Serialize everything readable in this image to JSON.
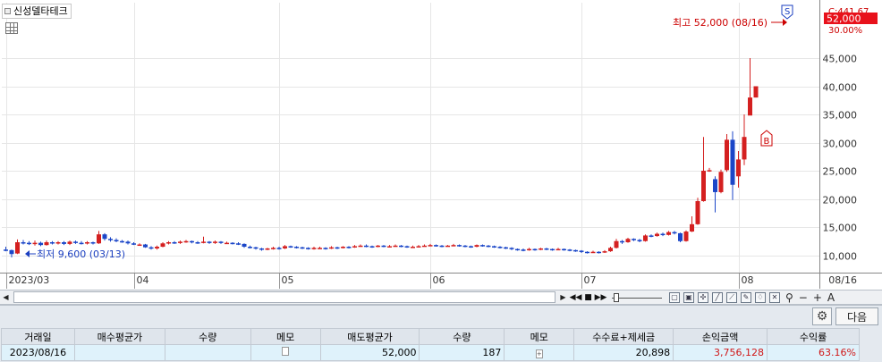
{
  "stock": {
    "name": "신성델타테크"
  },
  "price_tags": {
    "top_partial": "C:441.67",
    "current": "52,000",
    "percent": "30.00%"
  },
  "annotations": {
    "high": "최고 52,000 (08/16)",
    "low": "최저 9,600 (03/13)",
    "sell_marker": "S",
    "buy_marker": "B"
  },
  "colors": {
    "up": "#d42020",
    "down": "#1b46c8",
    "price_tag_bg": "#e8111b",
    "grid": "#e6e6e6"
  },
  "chart_data": {
    "type": "candlestick",
    "y_ticks": [
      "45,000",
      "40,000",
      "35,000",
      "30,000",
      "25,000",
      "20,000",
      "15,000",
      "10,000"
    ],
    "ylim": [
      6500,
      52000
    ],
    "x_ticks": [
      {
        "label": "2023/03",
        "index": 0
      },
      {
        "label": "04",
        "index": 22
      },
      {
        "label": "05",
        "index": 47
      },
      {
        "label": "06",
        "index": 73
      },
      {
        "label": "07",
        "index": 99
      },
      {
        "label": "08",
        "index": 126
      }
    ],
    "x_end_label": "08/16",
    "candles": [
      [
        11000,
        10900,
        11500,
        10700
      ],
      [
        10900,
        10200,
        11000,
        9600
      ],
      [
        10300,
        12300,
        12800,
        10200
      ],
      [
        12300,
        12200,
        12700,
        11900
      ],
      [
        12200,
        12000,
        12500,
        11800
      ],
      [
        12000,
        12200,
        12600,
        11700
      ],
      [
        12200,
        11800,
        12400,
        11600
      ],
      [
        11800,
        12300,
        12600,
        11700
      ],
      [
        12300,
        12100,
        12500,
        11900
      ],
      [
        12100,
        12300,
        12500,
        11900
      ],
      [
        12300,
        12000,
        12500,
        11800
      ],
      [
        12000,
        12400,
        12600,
        11800
      ],
      [
        12400,
        12200,
        12600,
        12000
      ],
      [
        12200,
        12100,
        12500,
        11900
      ],
      [
        12100,
        12300,
        12500,
        11900
      ],
      [
        12300,
        12100,
        12400,
        11900
      ],
      [
        12100,
        13700,
        14300,
        12000
      ],
      [
        13700,
        12900,
        13900,
        12600
      ],
      [
        12900,
        12700,
        13200,
        12400
      ],
      [
        12700,
        12500,
        13000,
        12300
      ],
      [
        12500,
        12400,
        12700,
        12200
      ],
      [
        12400,
        12100,
        12600,
        11900
      ],
      [
        12100,
        11900,
        12300,
        11800
      ],
      [
        11900,
        11900,
        12100,
        11700
      ],
      [
        11900,
        11400,
        12000,
        11300
      ],
      [
        11400,
        11200,
        11600,
        11000
      ],
      [
        11200,
        11500,
        11700,
        11000
      ],
      [
        11500,
        12100,
        12300,
        11400
      ],
      [
        12100,
        12300,
        12500,
        11900
      ],
      [
        12300,
        12200,
        12500,
        12000
      ],
      [
        12200,
        12400,
        12600,
        12000
      ],
      [
        12400,
        12500,
        12700,
        12200
      ],
      [
        12500,
        12300,
        12600,
        12100
      ],
      [
        12300,
        12200,
        12500,
        12000
      ],
      [
        12200,
        12400,
        13300,
        12100
      ],
      [
        12400,
        12200,
        12500,
        12000
      ],
      [
        12200,
        12400,
        12600,
        12000
      ],
      [
        12400,
        12200,
        12500,
        12000
      ],
      [
        12200,
        12200,
        12400,
        12000
      ],
      [
        12200,
        12100,
        12300,
        11900
      ],
      [
        12100,
        12000,
        12300,
        11800
      ],
      [
        12000,
        11500,
        12100,
        11300
      ],
      [
        11500,
        11400,
        11700,
        11200
      ],
      [
        11400,
        11200,
        11500,
        11000
      ],
      [
        11200,
        11000,
        11300,
        10800
      ],
      [
        11000,
        11200,
        11300,
        10900
      ],
      [
        11200,
        11300,
        11500,
        11000
      ],
      [
        11300,
        11200,
        11500,
        11000
      ],
      [
        11200,
        11600,
        11800,
        11100
      ],
      [
        11600,
        11500,
        11700,
        11300
      ],
      [
        11500,
        11400,
        11600,
        11200
      ],
      [
        11400,
        11300,
        11500,
        11100
      ],
      [
        11300,
        11200,
        11400,
        11000
      ],
      [
        11200,
        11300,
        11500,
        11000
      ],
      [
        11300,
        11300,
        11500,
        11100
      ],
      [
        11300,
        11200,
        11400,
        11000
      ],
      [
        11200,
        11400,
        11600,
        11100
      ],
      [
        11400,
        11300,
        11500,
        11100
      ],
      [
        11300,
        11500,
        11600,
        11200
      ],
      [
        11500,
        11400,
        11600,
        11200
      ],
      [
        11400,
        11600,
        11800,
        11300
      ],
      [
        11600,
        11700,
        11900,
        11500
      ],
      [
        11700,
        11600,
        11900,
        11400
      ],
      [
        11600,
        11500,
        11700,
        11300
      ],
      [
        11500,
        11700,
        11800,
        11400
      ],
      [
        11700,
        11600,
        11800,
        11400
      ],
      [
        11600,
        11600,
        11800,
        11400
      ],
      [
        11600,
        11700,
        11900,
        11500
      ],
      [
        11700,
        11600,
        11800,
        11400
      ],
      [
        11600,
        11500,
        11700,
        11300
      ],
      [
        11500,
        11500,
        11700,
        11300
      ],
      [
        11500,
        11600,
        11800,
        11400
      ],
      [
        11600,
        11700,
        11900,
        11500
      ],
      [
        11700,
        11800,
        12000,
        11600
      ],
      [
        11800,
        11700,
        11900,
        11500
      ],
      [
        11700,
        11600,
        11800,
        11400
      ],
      [
        11600,
        11700,
        11800,
        11500
      ],
      [
        11700,
        11800,
        12000,
        11600
      ],
      [
        11800,
        11700,
        11900,
        11500
      ],
      [
        11700,
        11600,
        11800,
        11400
      ],
      [
        11600,
        11500,
        11700,
        11300
      ],
      [
        11500,
        11800,
        11900,
        11400
      ],
      [
        11800,
        11700,
        11900,
        11500
      ],
      [
        11700,
        11600,
        11800,
        11400
      ],
      [
        11600,
        11500,
        11700,
        11300
      ],
      [
        11500,
        11400,
        11600,
        11200
      ],
      [
        11400,
        11300,
        11500,
        11100
      ],
      [
        11300,
        11100,
        11400,
        10900
      ],
      [
        11100,
        11000,
        11200,
        10800
      ],
      [
        11000,
        10900,
        11200,
        10700
      ],
      [
        10900,
        11100,
        11300,
        10800
      ],
      [
        11100,
        11000,
        11200,
        10800
      ],
      [
        11000,
        11200,
        11300,
        10900
      ],
      [
        11200,
        11100,
        11300,
        10900
      ],
      [
        11100,
        11000,
        11200,
        10800
      ],
      [
        11000,
        11100,
        11300,
        10900
      ],
      [
        11100,
        11000,
        11200,
        10800
      ],
      [
        11000,
        10900,
        11100,
        10700
      ],
      [
        10900,
        10800,
        11000,
        10600
      ],
      [
        10800,
        10600,
        10900,
        10400
      ],
      [
        10600,
        10500,
        10700,
        10300
      ],
      [
        10500,
        10600,
        10800,
        10400
      ],
      [
        10600,
        10500,
        10700,
        10300
      ],
      [
        10500,
        10700,
        10900,
        10400
      ],
      [
        10700,
        11300,
        11500,
        10600
      ],
      [
        11300,
        12500,
        12900,
        11200
      ],
      [
        12500,
        12300,
        12700,
        12000
      ],
      [
        12300,
        12900,
        13100,
        12200
      ],
      [
        12900,
        12700,
        13000,
        12500
      ],
      [
        12700,
        12500,
        12900,
        12300
      ],
      [
        12500,
        13500,
        13700,
        12400
      ],
      [
        13500,
        13400,
        13700,
        13200
      ],
      [
        13400,
        13800,
        14000,
        13300
      ],
      [
        13800,
        13600,
        14000,
        13400
      ],
      [
        13600,
        14100,
        14300,
        13500
      ],
      [
        14100,
        13900,
        14300,
        13700
      ],
      [
        13900,
        12500,
        14000,
        12300
      ],
      [
        12500,
        14200,
        14400,
        12400
      ],
      [
        14200,
        15500,
        16900,
        14100
      ],
      [
        15500,
        19600,
        20200,
        15400
      ],
      [
        19600,
        25000,
        31000,
        19500
      ],
      [
        25000,
        25100,
        25500,
        24800
      ],
      [
        23500,
        21200,
        24000,
        17600
      ],
      [
        21200,
        24800,
        25200,
        21000
      ],
      [
        25100,
        30500,
        31500,
        24800
      ],
      [
        30500,
        22500,
        32000,
        19800
      ],
      [
        24000,
        27000,
        28500,
        22000
      ],
      [
        27000,
        31000,
        35000,
        26000
      ],
      [
        34800,
        38000,
        45000,
        36800
      ],
      [
        38000,
        40000,
        40000,
        38000
      ]
    ]
  },
  "table": {
    "headers": [
      "거래일",
      "매수평균가",
      "수량",
      "메모",
      "매도평균가",
      "수량",
      "메모",
      "수수료+제세금",
      "손익금액",
      "수익률"
    ],
    "row": [
      "2023/08/16",
      "",
      "",
      "",
      "52,000",
      "187",
      "",
      "20,898",
      "3,756,128",
      "63.16%"
    ]
  },
  "buttons": {
    "next": "다음"
  }
}
